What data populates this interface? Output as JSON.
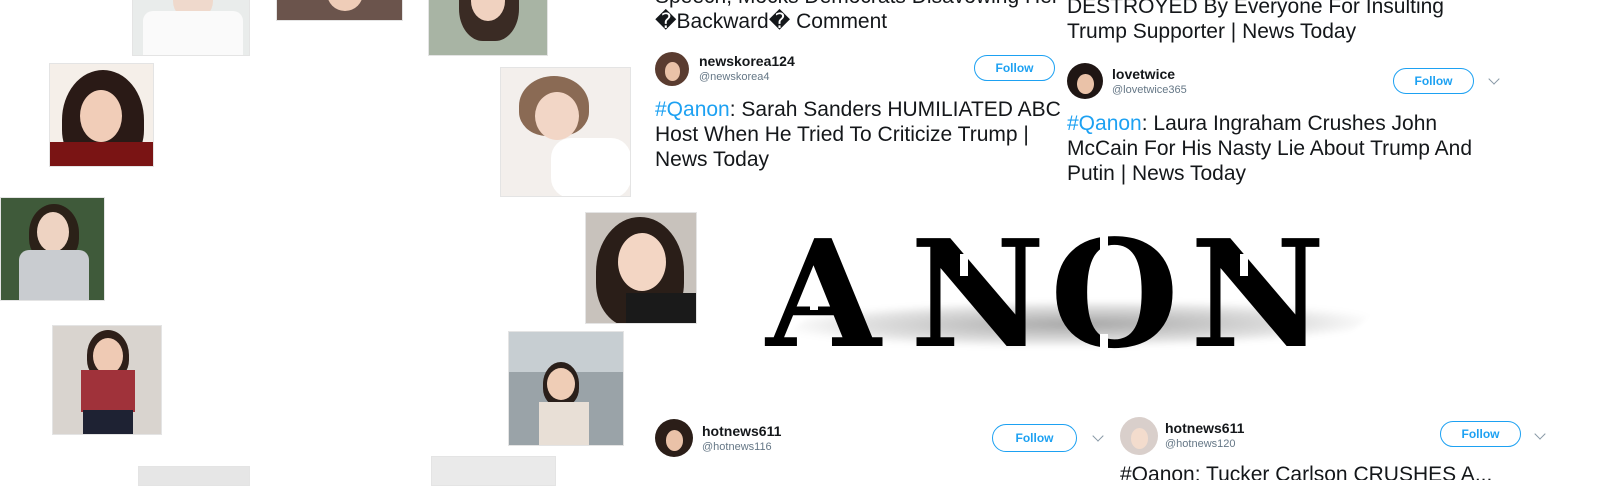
{
  "tweets": [
    {
      "top_text": "Speech, Mocks Democrats Disavowing Her\n�Backward� Comment",
      "user": {
        "name": "newskorea124",
        "handle": "@newskorea4"
      },
      "follow_label": "Follow",
      "hashtag": "#Qanon",
      "text": ": Sarah Sanders HUMILIATED ABC Host When He Tried To Criticize Trump | News Today"
    },
    {
      "top_text": "DESTROYED By Everyone For Insulting\nTrump Supporter | News Today",
      "user": {
        "name": "lovetwice",
        "handle": "@lovetwice365"
      },
      "follow_label": "Follow",
      "hashtag": "#Qanon",
      "text": ": Laura Ingraham Crushes John McCain For His Nasty Lie About Trump And Putin | News Today"
    },
    {
      "user": {
        "name": "hotnews611",
        "handle": "@hotnews116"
      },
      "follow_label": "Follow"
    },
    {
      "user": {
        "name": "hotnews611",
        "handle": "@hotnews120"
      },
      "follow_label": "Follow",
      "partial_text": "#Qanon: Tucker Carlson CRUSHES A..."
    }
  ],
  "banner": {
    "letters": [
      "A",
      "N",
      "O",
      "N"
    ]
  },
  "colors": {
    "hashtag": "#1da1f2",
    "follow_border": "#1da1f2",
    "text": "#14171a",
    "handle": "#657786"
  },
  "icons": [
    "chevron-down-icon"
  ]
}
